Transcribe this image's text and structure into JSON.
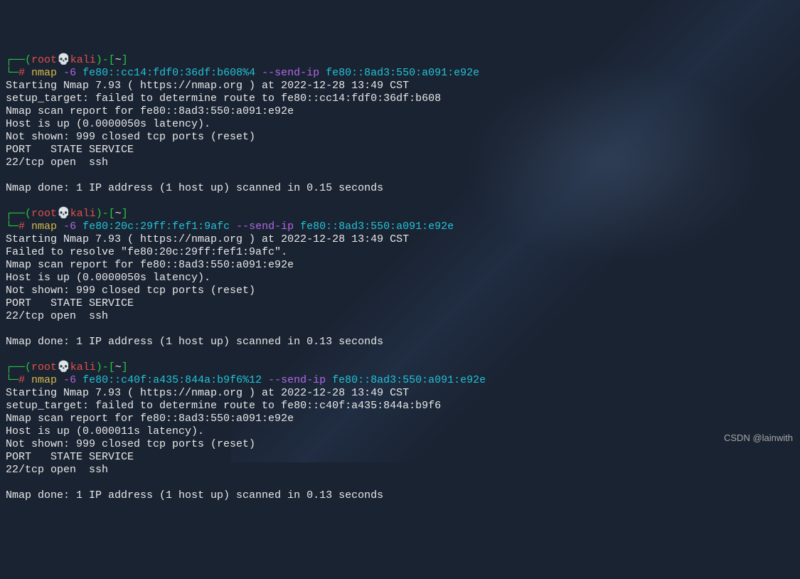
{
  "prompt": {
    "box_open": "┌──(",
    "user": "root",
    "skull": "💀",
    "host": "kali",
    "box_close": ")-[",
    "path": "~",
    "bracket_close": "]",
    "line2_prefix": "└─",
    "hash": "#"
  },
  "blocks": [
    {
      "cmd": {
        "prog": "nmap",
        "flag1": " -6",
        "arg1": " fe80::cc14:fdf0:36df:b608%4",
        "flag2": " --send-ip",
        "arg2": " fe80::8ad3:550:a091:e92e"
      },
      "out": [
        "Starting Nmap 7.93 ( https://nmap.org ) at 2022-12-28 13:49 CST",
        "setup_target: failed to determine route to fe80::cc14:fdf0:36df:b608",
        "Nmap scan report for fe80::8ad3:550:a091:e92e",
        "Host is up (0.0000050s latency).",
        "Not shown: 999 closed tcp ports (reset)",
        "PORT   STATE SERVICE",
        "22/tcp open  ssh",
        "",
        "Nmap done: 1 IP address (1 host up) scanned in 0.15 seconds"
      ]
    },
    {
      "cmd": {
        "prog": "nmap",
        "flag1": " -6",
        "arg1": " fe80:20c:29ff:fef1:9afc",
        "flag2": " --send-ip",
        "arg2": " fe80::8ad3:550:a091:e92e"
      },
      "out": [
        "Starting Nmap 7.93 ( https://nmap.org ) at 2022-12-28 13:49 CST",
        "Failed to resolve \"fe80:20c:29ff:fef1:9afc\".",
        "Nmap scan report for fe80::8ad3:550:a091:e92e",
        "Host is up (0.0000050s latency).",
        "Not shown: 999 closed tcp ports (reset)",
        "PORT   STATE SERVICE",
        "22/tcp open  ssh",
        "",
        "Nmap done: 1 IP address (1 host up) scanned in 0.13 seconds"
      ]
    },
    {
      "cmd": {
        "prog": "nmap",
        "flag1": " -6",
        "arg1": " fe80::c40f:a435:844a:b9f6%12",
        "flag2": " --send-ip",
        "arg2": " fe80::8ad3:550:a091:e92e"
      },
      "out": [
        "Starting Nmap 7.93 ( https://nmap.org ) at 2022-12-28 13:49 CST",
        "setup_target: failed to determine route to fe80::c40f:a435:844a:b9f6",
        "Nmap scan report for fe80::8ad3:550:a091:e92e",
        "Host is up (0.000011s latency).",
        "Not shown: 999 closed tcp ports (reset)",
        "PORT   STATE SERVICE",
        "22/tcp open  ssh",
        "",
        "Nmap done: 1 IP address (1 host up) scanned in 0.13 seconds"
      ]
    }
  ],
  "watermark": "CSDN @lainwith"
}
